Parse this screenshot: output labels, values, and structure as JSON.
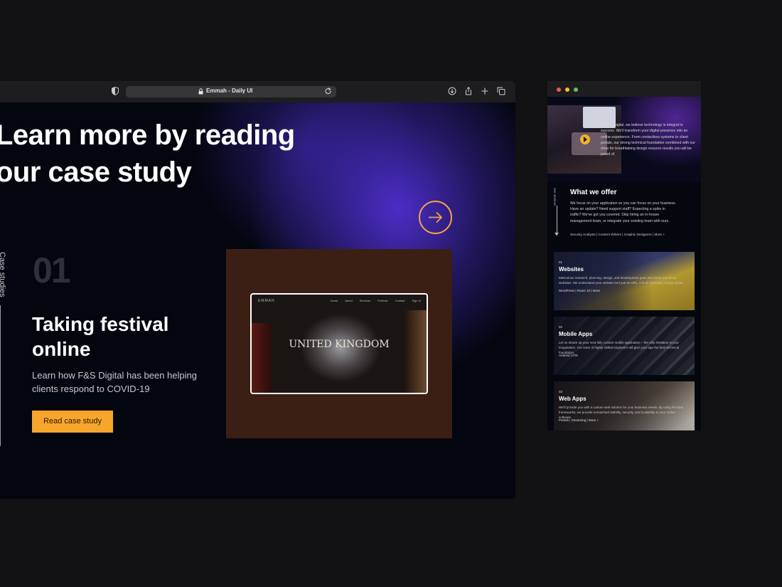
{
  "browser": {
    "tab_url_text": "Emmah - Daily UI",
    "toolbar_icons": [
      "shield-icon",
      "lock-icon",
      "reload-icon",
      "download-icon",
      "share-icon",
      "new-tab-icon",
      "tabs-icon"
    ]
  },
  "hero": {
    "line1": "Learn more by reading",
    "line2": "our case study"
  },
  "sidebar": {
    "vertical_label": "Case studies"
  },
  "case": {
    "number": "01",
    "title": "Taking festival online",
    "description": "Learn how F&S Digital has been helping clients respond to COVID-19",
    "cta_label": "Read case study"
  },
  "preview": {
    "logo": "EMMAH",
    "nav": [
      "Home",
      "About",
      "Services",
      "Portfolio",
      "Contact",
      "Sign In"
    ],
    "headline": "UNITED KINGDOM"
  },
  "right_window": {
    "intro": "At F&S Digital, we believe technology is integral to success. We'll transform your digital presence into an online experience. From contactless systems to client portals, our strong technical foundation combined with our drive for breathtaking design ensures results you will be proud of.",
    "services_vertical": "Our services",
    "what_we_offer": {
      "title": "What we offer",
      "description": "We focus on your application so you can focus on your business. Have an update? Need support staff? Expecting a spike in traffic? We've got you covered. Skip hiring an in-house management team, or integrate your existing team with ours.",
      "links": "Security Analysts  |  Content Writers  |  Graphic Designers  |  More +"
    },
    "services": [
      {
        "number": "01",
        "title": "Websites",
        "description": "Meticulous research, planning, design, and development goes into every one of our websites. We understand your website isn't just an URL, it is an extension of your vision.",
        "tags": "WordPress | React JS | More"
      },
      {
        "number": "02",
        "title": "Mobile Apps",
        "description": "Let us dream up your next fully custom mobile application – the only limitation is your imagination. Our team of highly skilled engineers will give your app the best technical foundation.",
        "tags": "Android | IOS"
      },
      {
        "number": "03",
        "title": "Web Apps",
        "description": "We'll provide you with a custom web solution for your business needs. By using the best frameworks, we provide unmatched stability, security, and scalability to your online software.",
        "tags": "Portals  |  Streaming  |  More +"
      }
    ]
  },
  "colors": {
    "accent_orange": "#f7a52b",
    "ring_orange": "#f0a24a",
    "background": "#121113",
    "glow_purple": "#5834e8"
  }
}
